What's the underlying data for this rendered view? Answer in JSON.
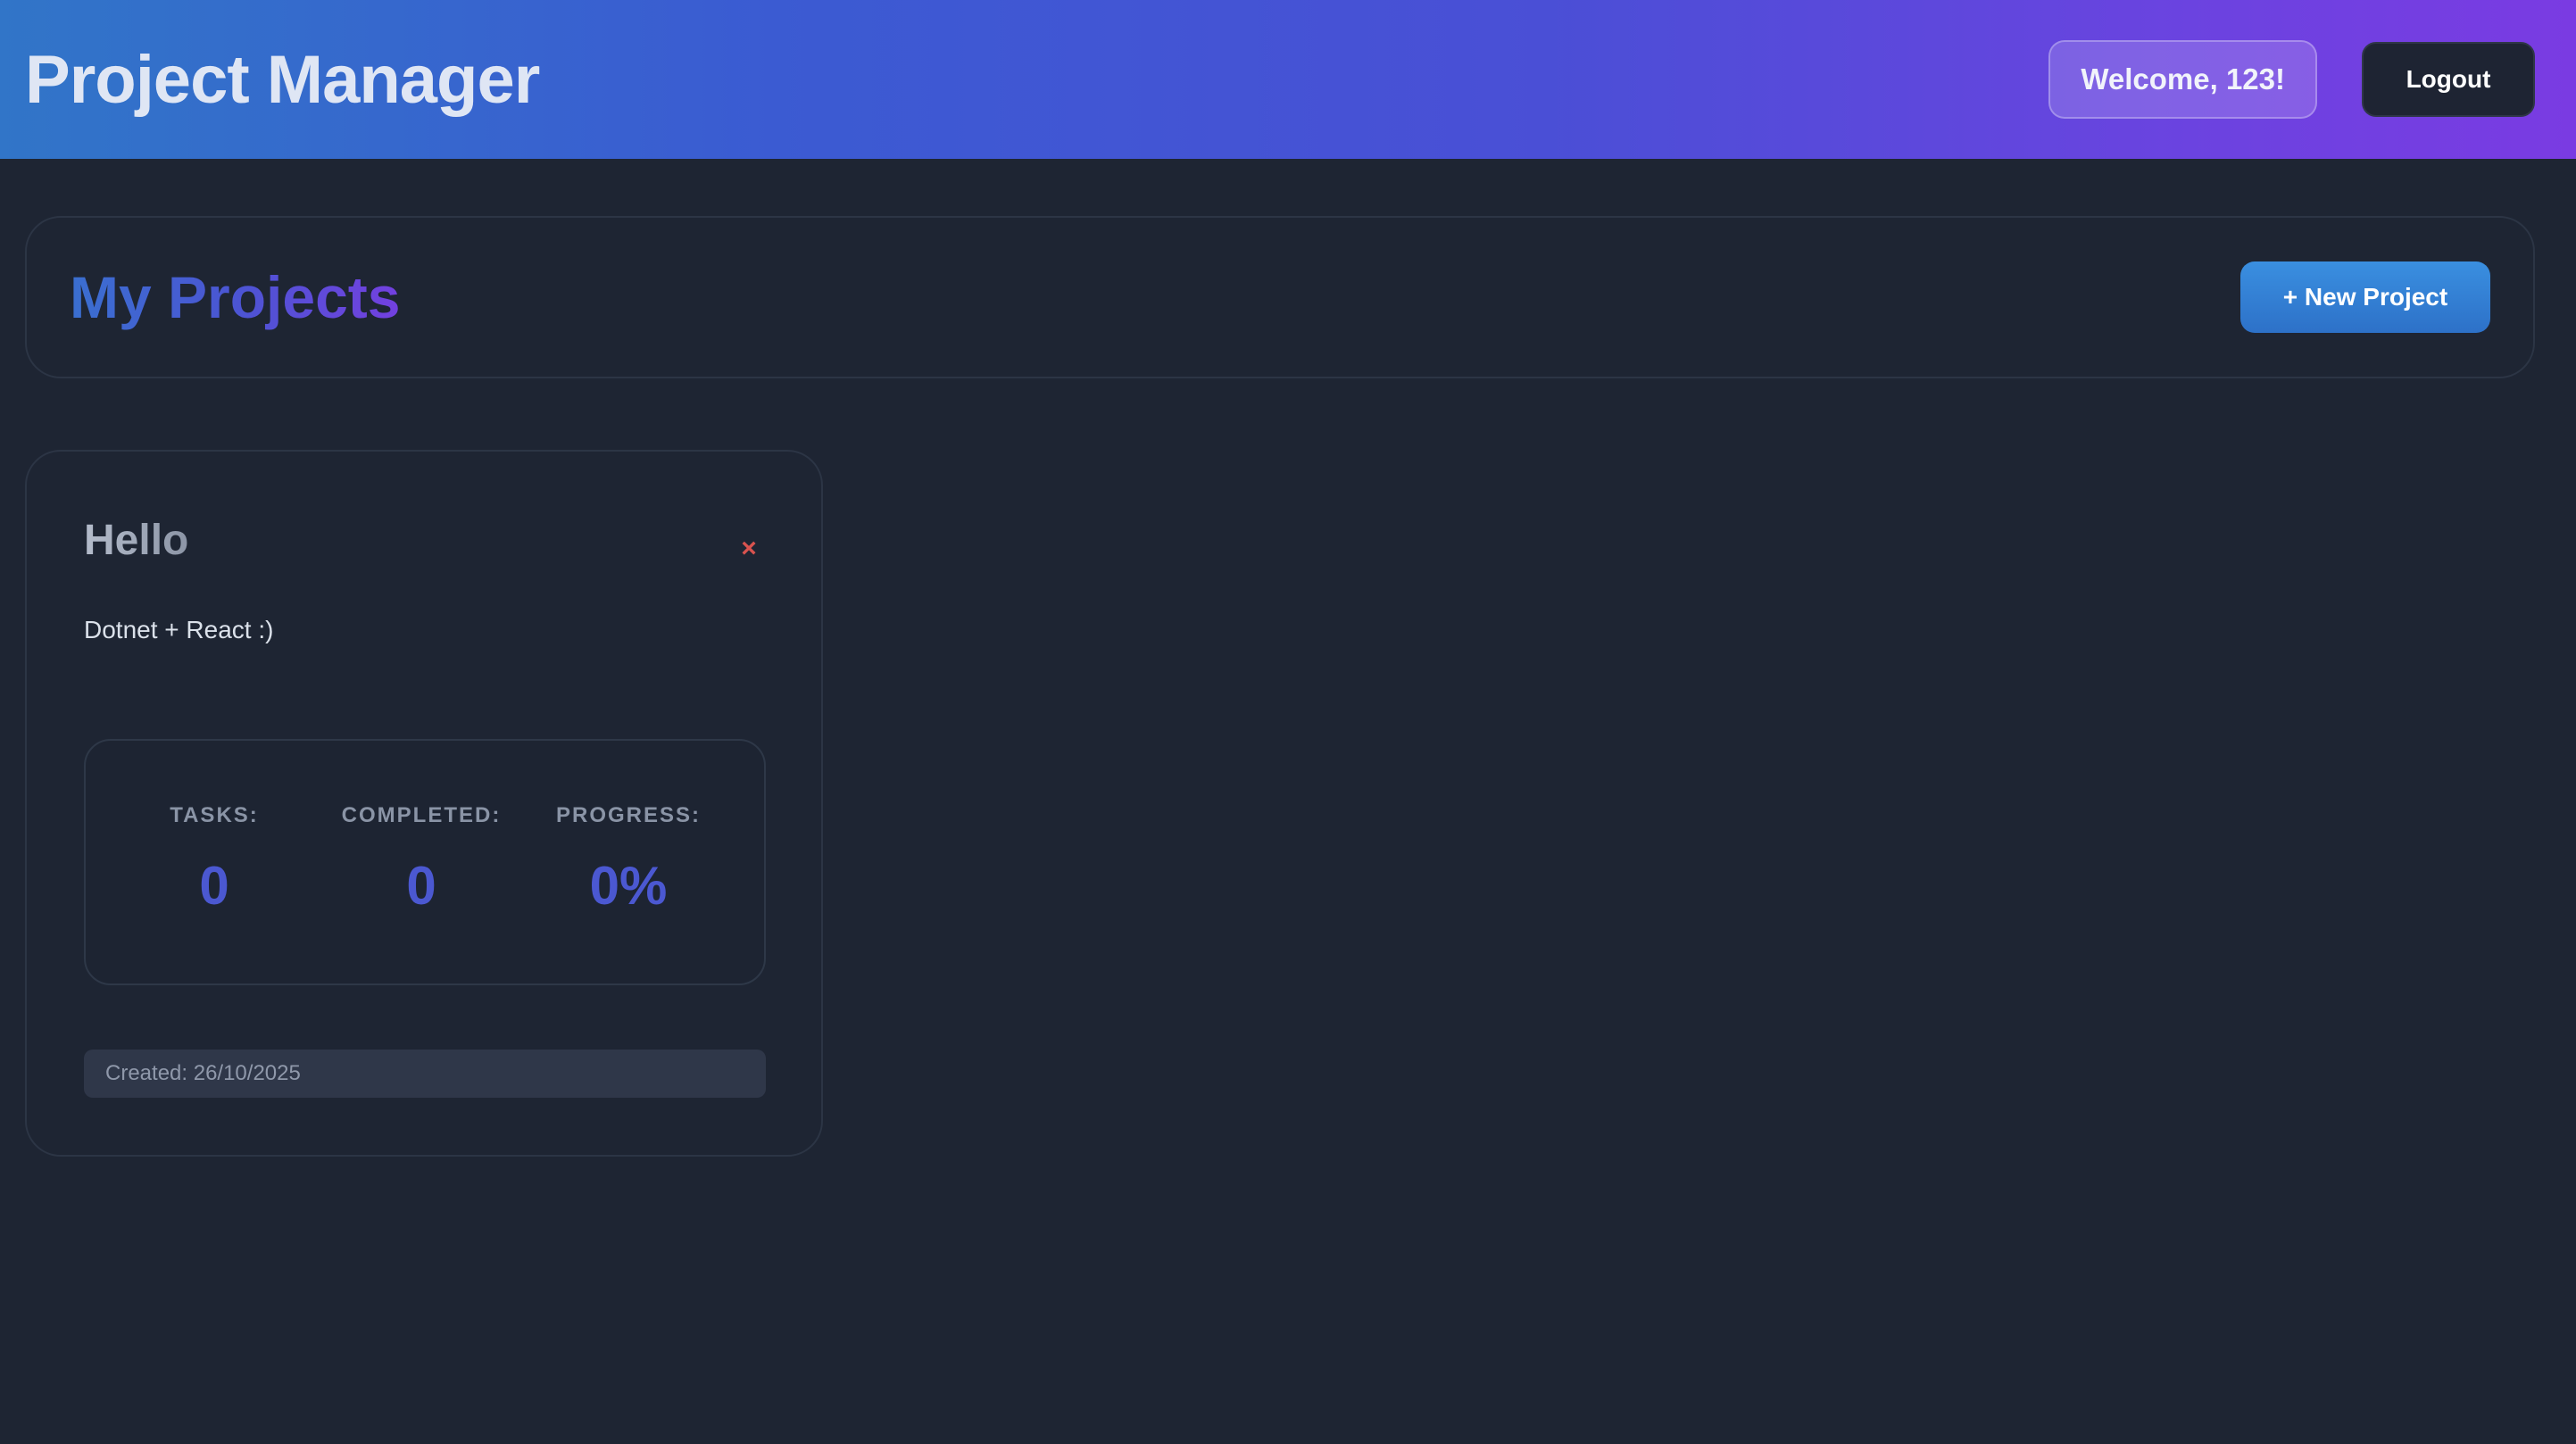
{
  "header": {
    "title": "Project Manager",
    "welcome": "Welcome, 123!",
    "logout_label": "Logout"
  },
  "projects_section": {
    "title": "My Projects",
    "new_project_label": "+ New Project"
  },
  "projects": [
    {
      "name": "Hello",
      "description": "Dotnet + React :)",
      "delete_icon": "×",
      "stats": {
        "tasks_label": "TASKS:",
        "tasks_value": "0",
        "completed_label": "COMPLETED:",
        "completed_value": "0",
        "progress_label": "PROGRESS:",
        "progress_value": "0%"
      },
      "created": "Created: 26/10/2025"
    }
  ],
  "colors": {
    "background": "#1e2533",
    "header_gradient_start": "#3175c8",
    "header_gradient_end": "#7a3be2",
    "accent_blue": "#2d71c8",
    "stat_value": "#4b58d1",
    "delete_red": "#d9534f"
  },
  "icons": {
    "delete": "close-icon"
  }
}
